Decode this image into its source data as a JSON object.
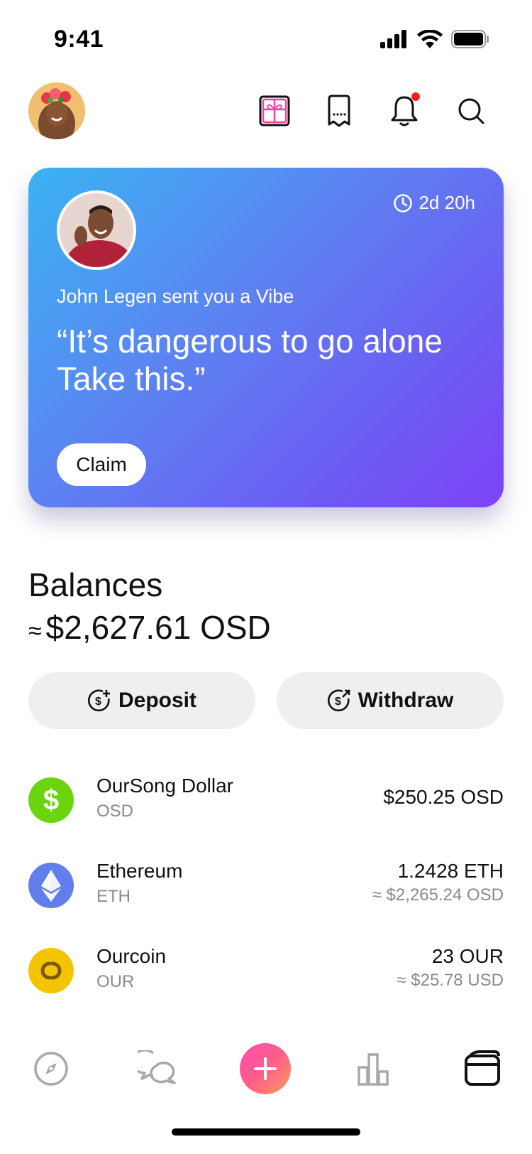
{
  "status_bar": {
    "time": "9:41",
    "icons": [
      "signal-icon",
      "wifi-icon",
      "battery-icon"
    ]
  },
  "header": {
    "icons": [
      "gift-icon",
      "receipt-icon",
      "bell-icon",
      "search-icon"
    ],
    "has_notification": true
  },
  "vibe": {
    "timer": "2d 20h",
    "from_text": "John Legen sent you a Vibe",
    "quote": "“It’s dangerous to go alone Take this.”",
    "claim_label": "Claim"
  },
  "balances": {
    "title": "Balances",
    "approx": "≈",
    "total": "$2,627.61 OSD"
  },
  "actions": {
    "deposit_label": "Deposit",
    "withdraw_label": "Withdraw"
  },
  "assets": [
    {
      "name": "OurSong Dollar",
      "symbol": "OSD",
      "amount": "$250.25 OSD",
      "fiat": "",
      "color": "#6ad40f"
    },
    {
      "name": "Ethereum",
      "symbol": "ETH",
      "amount": "1.2428 ETH",
      "fiat": "≈ $2,265.24 OSD",
      "color": "#627eea"
    },
    {
      "name": "Ourcoin",
      "symbol": "OUR",
      "amount": "23 OUR",
      "fiat": "≈ $25.78 USD",
      "color": "#f5c400"
    }
  ],
  "tab_bar": {
    "items": [
      "explore-icon",
      "chat-icon",
      "add-icon",
      "stats-icon",
      "wallet-icon"
    ],
    "active": "wallet-icon"
  },
  "colors": {
    "card_gradient_start": "#3ab3f2",
    "card_gradient_end": "#7d43f6",
    "add_button_start": "#ff4db0",
    "add_button_end": "#ff9a5a",
    "notification_dot": "#ff1e1e"
  }
}
